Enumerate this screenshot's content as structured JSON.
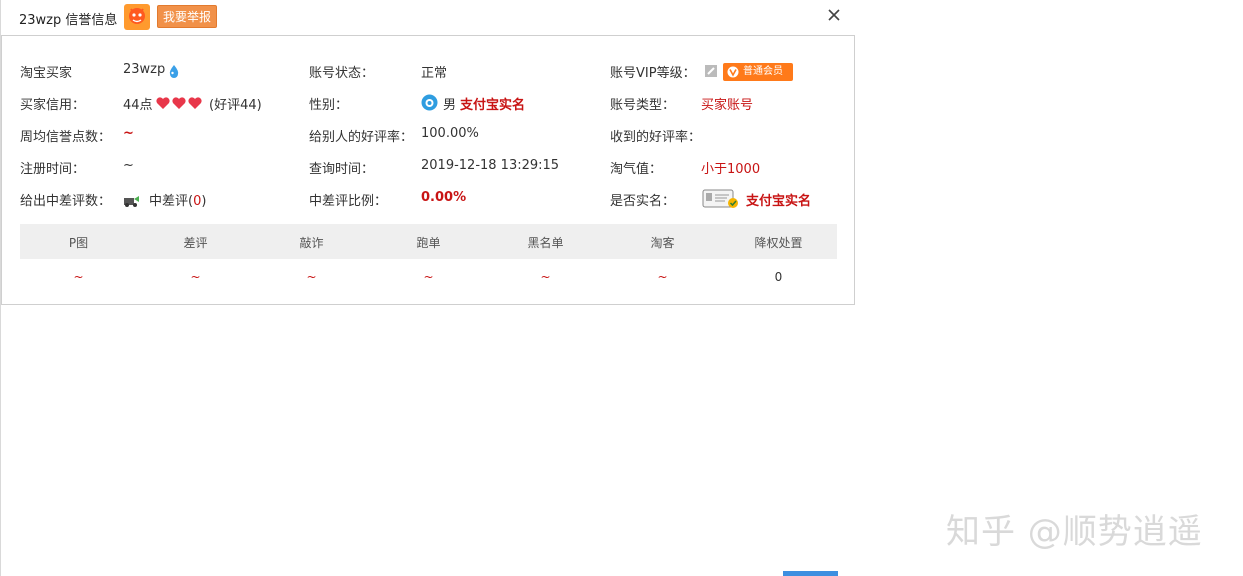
{
  "dialog": {
    "title": "23wzp 信誉信息",
    "report_label": "我要举报"
  },
  "info": {
    "buyer_label": "淘宝买家",
    "buyer_name": "23wzp",
    "credit_label": "买家信用：",
    "credit_points": "44点",
    "credit_good": "(好评44)",
    "weekly_label": "周均信誉点数：",
    "weekly_value": "~",
    "register_label": "注册时间：",
    "register_value": "~",
    "negative_label": "给出中差评数：",
    "negative_text_prefix": "中差评(",
    "negative_count": "0",
    "negative_text_suffix": ")",
    "account_status_label": "账号状态：",
    "account_status_value": "正常",
    "gender_label": "性别：",
    "gender_value": "男",
    "gender_verify": "支付宝实名",
    "given_rate_label": "给别人的好评率：",
    "given_rate_value": "100.00%",
    "query_time_label": "查询时间：",
    "query_time_value": "2019-12-18 13:29:15",
    "neg_ratio_label": "中差评比例：",
    "neg_ratio_value": "0.00%",
    "vip_label": "账号VIP等级：",
    "vip_badge": "普通会员",
    "account_type_label": "账号类型：",
    "account_type_value": "买家账号",
    "received_rate_label": "收到的好评率：",
    "taoqi_label": "淘气值：",
    "taoqi_value": "小于1000",
    "realname_label": "是否实名：",
    "realname_value": "支付宝实名"
  },
  "table": {
    "headers": [
      "P图",
      "差评",
      "敲诈",
      "跑单",
      "黑名单",
      "淘客",
      "降权处置"
    ],
    "values": [
      "~",
      "~",
      "~",
      "~",
      "~",
      "~",
      "0"
    ]
  },
  "watermark": "知乎 @顺势逍遥",
  "colors": {
    "accent_orange": "#f19149",
    "value_red": "#c81414",
    "table_header_bg": "#efefef"
  }
}
